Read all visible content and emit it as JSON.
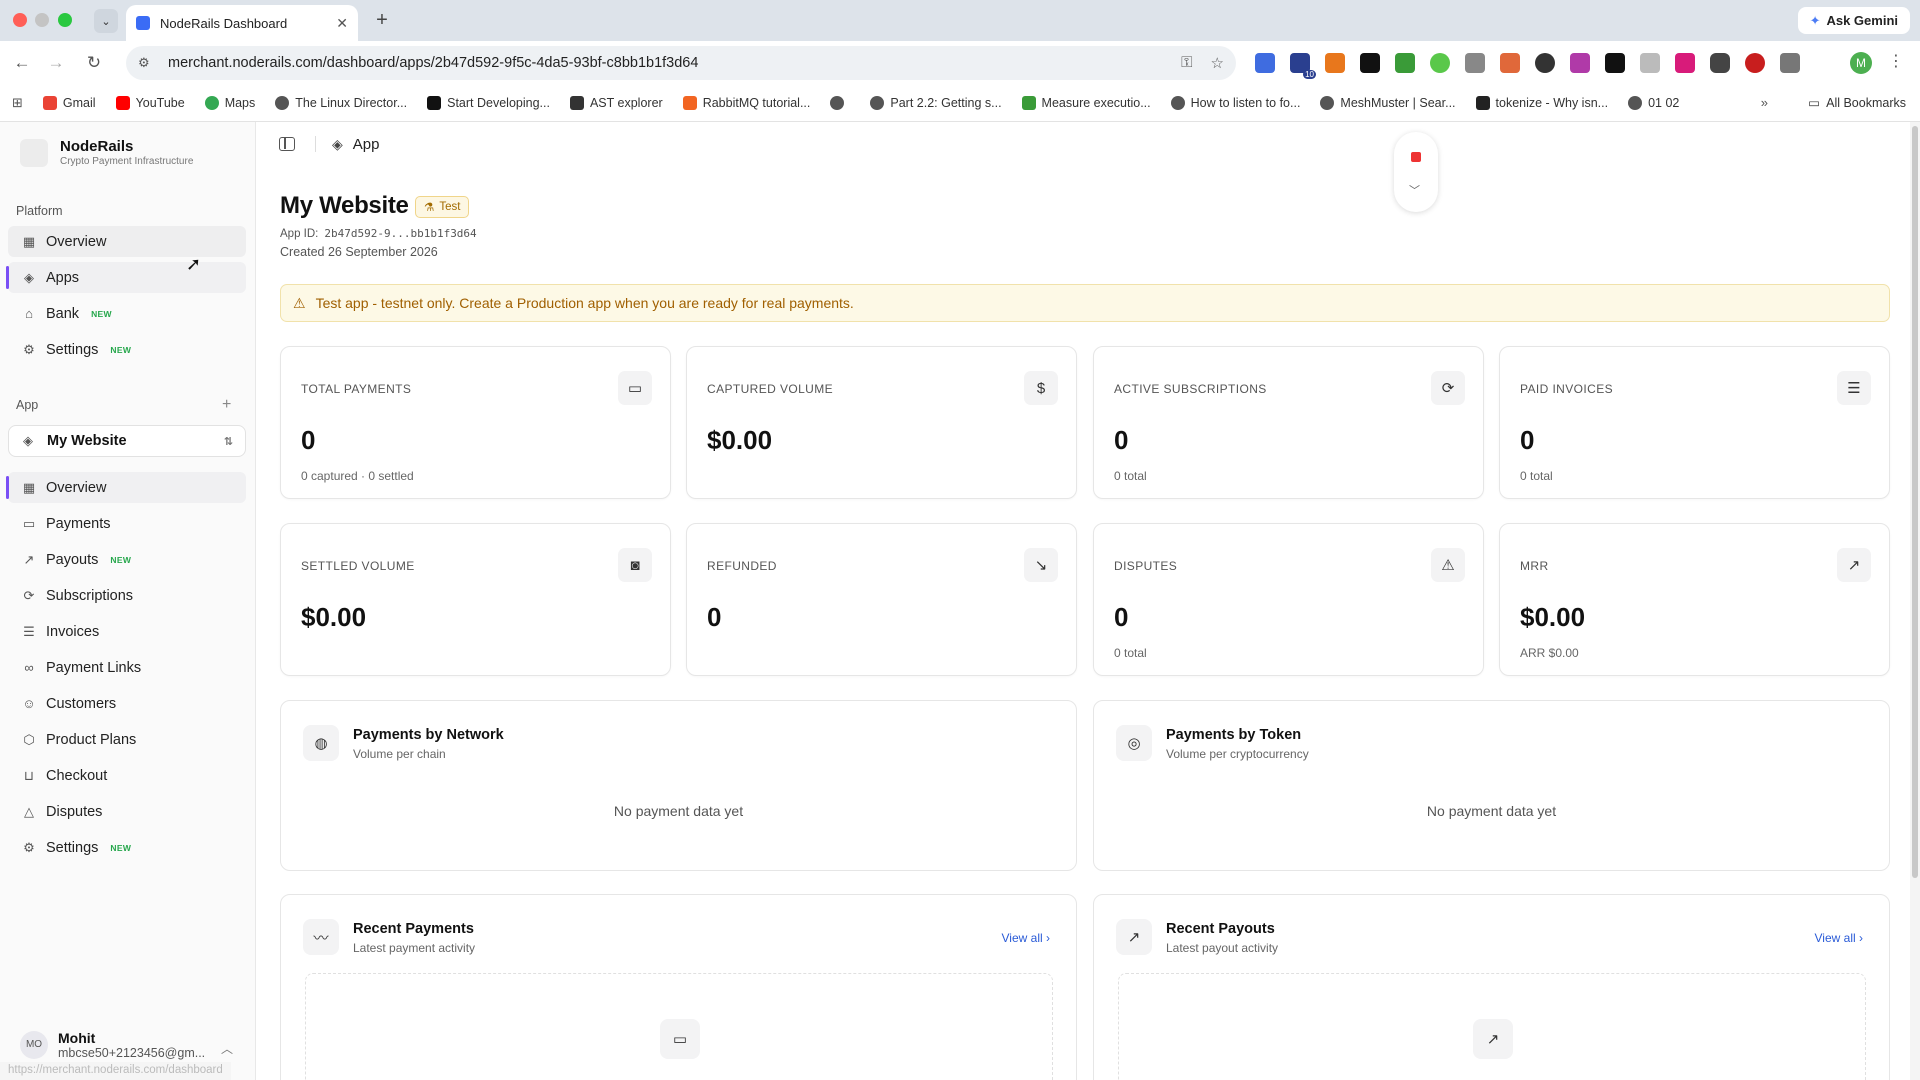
{
  "browser": {
    "tab_title": "NodeRails Dashboard",
    "url": "merchant.noderails.com/dashboard/apps/2b47d592-9f5c-4da5-93bf-c8bb1b1f3d64",
    "ask_gemini": "Ask Gemini",
    "profile_initial": "M",
    "bookmarks": [
      "Gmail",
      "YouTube",
      "Maps",
      "The Linux Director...",
      "Start Developing...",
      "AST explorer",
      "RabbitMQ tutorial...",
      "",
      "Part 2.2: Getting s...",
      "Measure executio...",
      "How to listen to fo...",
      "MeshMuster | Sear...",
      "tokenize - Why isn...",
      "01 02"
    ],
    "all_bookmarks": "All Bookmarks",
    "extension_badge": "10",
    "status_url": "https://merchant.noderails.com/dashboard"
  },
  "sidebar": {
    "brand_name": "NodeRails",
    "brand_sub": "Crypto Payment Infrastructure",
    "platform_label": "Platform",
    "platform_items": [
      {
        "label": "Overview",
        "badge": ""
      },
      {
        "label": "Apps",
        "badge": ""
      },
      {
        "label": "Bank",
        "badge": "NEW"
      },
      {
        "label": "Settings",
        "badge": "NEW"
      }
    ],
    "app_label": "App",
    "app_selected": "My Website",
    "app_items": [
      {
        "label": "Overview",
        "badge": ""
      },
      {
        "label": "Payments",
        "badge": ""
      },
      {
        "label": "Payouts",
        "badge": "NEW"
      },
      {
        "label": "Subscriptions",
        "badge": ""
      },
      {
        "label": "Invoices",
        "badge": ""
      },
      {
        "label": "Payment Links",
        "badge": ""
      },
      {
        "label": "Customers",
        "badge": ""
      },
      {
        "label": "Product Plans",
        "badge": ""
      },
      {
        "label": "Checkout",
        "badge": ""
      },
      {
        "label": "Disputes",
        "badge": ""
      },
      {
        "label": "Settings",
        "badge": "NEW"
      }
    ],
    "user": {
      "initials": "MO",
      "name": "Mohit",
      "email": "mbcse50+2123456@gm..."
    }
  },
  "header": {
    "breadcrumb": "App"
  },
  "page": {
    "title": "My Website",
    "badge": "Test",
    "app_id_label": "App ID:",
    "app_id_value": "2b47d592-9...bb1b1f3d64",
    "created": "Created 26 September 2026",
    "alert": "Test app - testnet only. Create a Production app when you are ready for real payments."
  },
  "stats": [
    {
      "label": "TOTAL PAYMENTS",
      "value": "0",
      "sub": "0 captured · 0 settled",
      "icon": "card-icon"
    },
    {
      "label": "CAPTURED VOLUME",
      "value": "$0.00",
      "sub": "",
      "icon": "dollar-icon"
    },
    {
      "label": "ACTIVE SUBSCRIPTIONS",
      "value": "0",
      "sub": "0 total",
      "icon": "refresh-icon"
    },
    {
      "label": "PAID INVOICES",
      "value": "0",
      "sub": "0 total",
      "icon": "receipt-icon"
    },
    {
      "label": "SETTLED VOLUME",
      "value": "$0.00",
      "sub": "",
      "icon": "banknote-icon"
    },
    {
      "label": "REFUNDED",
      "value": "0",
      "sub": "",
      "icon": "arrow-down-right-icon"
    },
    {
      "label": "DISPUTES",
      "value": "0",
      "sub": "0 total",
      "icon": "warning-icon"
    },
    {
      "label": "MRR",
      "value": "$0.00",
      "sub": "ARR $0.00",
      "icon": "trend-up-icon"
    }
  ],
  "panels": {
    "network": {
      "title": "Payments by Network",
      "sub": "Volume per chain",
      "empty": "No payment data yet"
    },
    "token": {
      "title": "Payments by Token",
      "sub": "Volume per cryptocurrency",
      "empty": "No payment data yet"
    },
    "recent_payments": {
      "title": "Recent Payments",
      "sub": "Latest payment activity",
      "view_all": "View all"
    },
    "recent_payouts": {
      "title": "Recent Payouts",
      "sub": "Latest payout activity",
      "view_all": "View all"
    }
  }
}
